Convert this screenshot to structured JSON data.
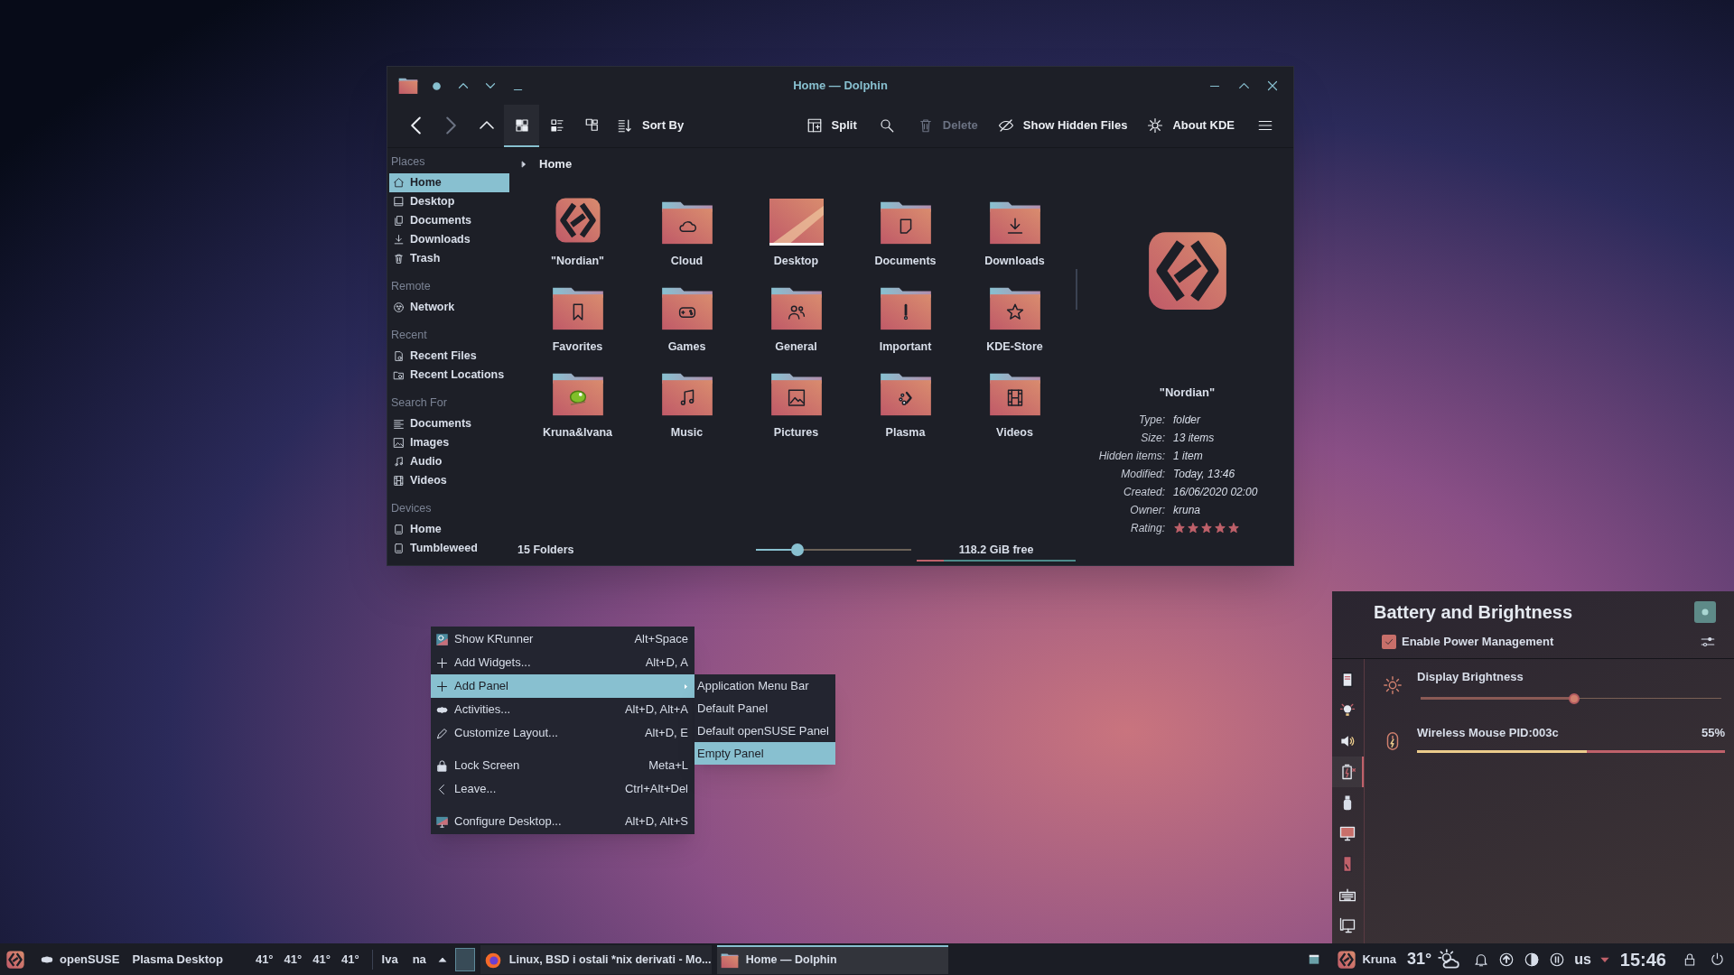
{
  "dolphin": {
    "title": "Home — Dolphin",
    "toolbar_left": [
      {
        "kind": "back",
        "disabled": false,
        "selected": false
      },
      {
        "kind": "forward",
        "disabled": true,
        "selected": false
      },
      {
        "kind": "up",
        "disabled": false,
        "selected": false
      },
      {
        "kind": "icons",
        "disabled": false,
        "selected": true
      },
      {
        "kind": "compact",
        "disabled": false,
        "selected": false
      },
      {
        "kind": "details",
        "disabled": false,
        "selected": false
      },
      {
        "kind": "sort",
        "label": "Sort By",
        "disabled": false,
        "selected": false
      }
    ],
    "toolbar_right": [
      {
        "kind": "split",
        "label": "Split",
        "disabled": false
      },
      {
        "kind": "search",
        "disabled": false
      },
      {
        "kind": "trash",
        "label": "Delete",
        "disabled": true
      },
      {
        "kind": "hidden",
        "label": "Show Hidden Files",
        "disabled": false
      },
      {
        "kind": "gear",
        "label": "About KDE",
        "disabled": false
      },
      {
        "kind": "menu",
        "disabled": false
      }
    ],
    "places": [
      {
        "heading": "Places",
        "items": [
          {
            "label": "Home",
            "kind": "home",
            "selected": true
          },
          {
            "label": "Desktop",
            "kind": "desktop",
            "selected": false
          },
          {
            "label": "Documents",
            "kind": "documents",
            "selected": false
          },
          {
            "label": "Downloads",
            "kind": "download",
            "selected": false
          },
          {
            "label": "Trash",
            "kind": "trash",
            "selected": false
          }
        ]
      },
      {
        "heading": "Remote",
        "items": [
          {
            "label": "Network",
            "kind": "network",
            "selected": false
          }
        ]
      },
      {
        "heading": "Recent",
        "items": [
          {
            "label": "Recent Files",
            "kind": "recentfile",
            "selected": false
          },
          {
            "label": "Recent Locations",
            "kind": "recentfolder",
            "selected": false
          }
        ]
      },
      {
        "heading": "Search For",
        "items": [
          {
            "label": "Documents",
            "kind": "list",
            "selected": false
          },
          {
            "label": "Images",
            "kind": "image",
            "selected": false
          },
          {
            "label": "Audio",
            "kind": "music",
            "selected": false
          },
          {
            "label": "Videos",
            "kind": "film",
            "selected": false
          }
        ]
      },
      {
        "heading": "Devices",
        "items": [
          {
            "label": "Home",
            "kind": "drive",
            "selected": false
          },
          {
            "label": "Tumbleweed",
            "kind": "drive",
            "selected": false
          }
        ]
      }
    ],
    "breadcrumb": "Home",
    "folders": [
      {
        "name": "\"Nordian\"",
        "kind": "logo"
      },
      {
        "name": "Cloud",
        "kind": "cloud"
      },
      {
        "name": "Desktop",
        "kind": "wallpaper"
      },
      {
        "name": "Documents",
        "kind": "document"
      },
      {
        "name": "Downloads",
        "kind": "download"
      },
      {
        "name": "Favorites",
        "kind": "bookmark"
      },
      {
        "name": "Games",
        "kind": "gamepad"
      },
      {
        "name": "General",
        "kind": "people"
      },
      {
        "name": "Important",
        "kind": "exclamation"
      },
      {
        "name": "KDE-Store",
        "kind": "star"
      },
      {
        "name": "Kruna&Ivana",
        "kind": "lizard"
      },
      {
        "name": "Music",
        "kind": "music"
      },
      {
        "name": "Pictures",
        "kind": "image"
      },
      {
        "name": "Plasma",
        "kind": "plasma"
      },
      {
        "name": "Videos",
        "kind": "film"
      }
    ],
    "status": "15 Folders",
    "zoom": {
      "level": 0.27
    },
    "free_space": {
      "text": "118.2 GiB free",
      "level": 0.17
    },
    "info": {
      "name": "\"Nordian\"",
      "details": [
        {
          "label": "Type:",
          "value": "folder"
        },
        {
          "label": "Size:",
          "value": "13 items"
        },
        {
          "label": "Hidden items:",
          "value": "1 item"
        },
        {
          "label": "Modified:",
          "value": "Today, 13:46"
        },
        {
          "label": "Created:",
          "value": "16/06/2020 02:00"
        },
        {
          "label": "Owner:",
          "value": "kruna"
        }
      ],
      "rating_label": "Rating:",
      "stars": 5
    }
  },
  "desktop_menu": {
    "items": [
      {
        "kind": "krunner",
        "label": "Show KRunner",
        "shortcut": "Alt+Space",
        "selected": false,
        "submenu": false
      },
      {
        "kind": "plus",
        "label": "Add Widgets...",
        "shortcut": "Alt+D, A",
        "selected": false,
        "submenu": false
      },
      {
        "kind": "plus",
        "label": "Add Panel",
        "selected": true,
        "submenu": true
      },
      {
        "kind": "activities",
        "label": "Activities...",
        "shortcut": "Alt+D, Alt+A",
        "selected": false,
        "submenu": false
      },
      {
        "kind": "pencil",
        "label": "Customize Layout...",
        "shortcut": "Alt+D, E",
        "selected": false,
        "submenu": false
      },
      {
        "kind": "separator"
      },
      {
        "kind": "lock",
        "label": "Lock Screen",
        "shortcut": "Meta+L",
        "selected": false,
        "submenu": false
      },
      {
        "kind": "leave",
        "label": "Leave...",
        "shortcut": "Ctrl+Alt+Del",
        "selected": false,
        "submenu": false
      },
      {
        "kind": "separator"
      },
      {
        "kind": "configure",
        "label": "Configure Desktop...",
        "shortcut": "Alt+D, Alt+S",
        "selected": false,
        "submenu": false
      }
    ],
    "submenu": [
      {
        "label": "Application Menu Bar",
        "selected": false
      },
      {
        "label": "Default Panel",
        "selected": false
      },
      {
        "label": "Default openSUSE Panel",
        "selected": false
      },
      {
        "label": "Empty Panel",
        "selected": true
      }
    ]
  },
  "battery": {
    "title": "Battery and Brightness",
    "power_management": {
      "label": "Enable Power Management",
      "checked": true
    },
    "categories": [
      {
        "kind": "notes",
        "selected": false
      },
      {
        "kind": "bulb",
        "selected": false
      },
      {
        "kind": "speaker",
        "selected": false
      },
      {
        "kind": "battery",
        "selected": true
      },
      {
        "kind": "usb",
        "selected": false
      },
      {
        "kind": "monitor",
        "selected": false
      },
      {
        "kind": "phone",
        "selected": false
      },
      {
        "kind": "keyboard",
        "selected": false
      },
      {
        "kind": "computer",
        "selected": false
      }
    ],
    "brightness": {
      "label": "Display Brightness",
      "level": 0.51
    },
    "devices": [
      {
        "name": "Wireless Mouse PID:003c",
        "reading": "55%",
        "level": 0.55
      }
    ]
  },
  "taskbar": {
    "activity": "openSUSE",
    "desktop": "Plasma Desktop",
    "temperatures": [
      "41°",
      "41°",
      "41°",
      "41°"
    ],
    "widgets": [
      "Iva",
      "na"
    ],
    "tasks": [
      {
        "kind": "browser",
        "title": "Linux, BSD i ostali *nix derivati - Mo...",
        "selected": false
      },
      {
        "kind": "files",
        "title": "Home — Dolphin",
        "selected": true
      }
    ],
    "user": "Kruna",
    "weather": "31°",
    "keyboard_layout": "us",
    "clock": "15:46"
  }
}
